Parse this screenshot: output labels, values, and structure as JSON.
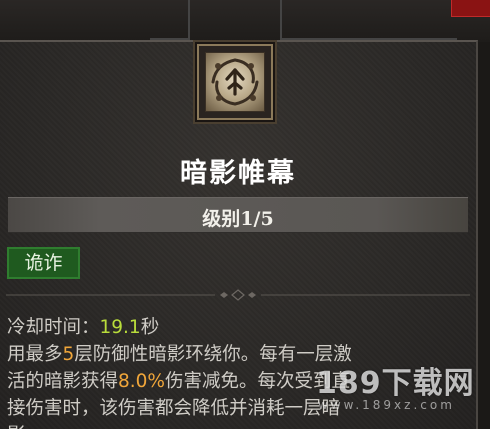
{
  "skill": {
    "name": "暗影帷幕",
    "level": "级别1/5",
    "tag": "诡诈"
  },
  "description": {
    "cooldown_label": "冷却时间：",
    "cooldown_value": "19.1",
    "cooldown_unit": "秒",
    "line1_prefix": "用最多",
    "max_layers": "5",
    "line1_suffix": "层防御性暗影环绕你。每有一层激",
    "line2_prefix": "活的暗影获得",
    "damage_reduction": "8.0%",
    "line2_suffix": "伤害减免。每次受到直",
    "line3": "接伤害时，该伤害都会降低并消耗一层暗",
    "line4": "影。"
  },
  "watermark": {
    "brand": "189下载网",
    "url": "www.189xz.com"
  },
  "icons": {
    "skill_icon": "shadow-shroud-skill-icon",
    "divider": "ornate-divider-icon"
  },
  "colors": {
    "cooldown_value": "#b9dd3b",
    "highlight": "#f0a63a",
    "tag_bg": "#1f5a1f",
    "body_text": "#cfccc6"
  }
}
